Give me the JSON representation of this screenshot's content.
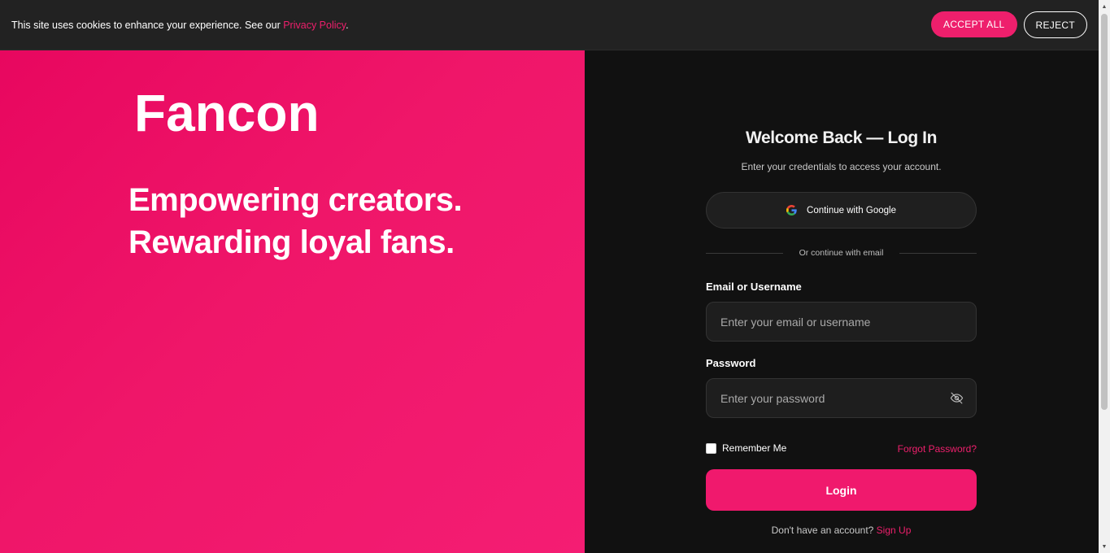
{
  "cookie_bar": {
    "text": "This site uses cookies to enhance your experience. See our ",
    "policy_link": "Privacy Policy",
    "period": ".",
    "accept_label": "ACCEPT ALL",
    "reject_label": "REJECT"
  },
  "hero": {
    "brand": "Fancon",
    "tagline": "Empowering creators. Rewarding loyal fans."
  },
  "login": {
    "title": "Welcome Back — Log In",
    "subtitle": "Enter your credentials to access your account.",
    "google_label": "Continue with Google",
    "divider_text": "Or continue with email",
    "email_label": "Email or Username",
    "email_placeholder": "Enter your email or username",
    "password_label": "Password",
    "password_placeholder": "Enter your password",
    "remember_label": "Remember Me",
    "forgot_label": "Forgot Password?",
    "login_label": "Login",
    "signup_prompt": "Don't have an account?",
    "signup_link": "Sign Up"
  },
  "icons": {
    "google": "google-icon",
    "eye": "eye-off-icon"
  },
  "colors": {
    "accent": "#ee1f6c",
    "hero_bg": "#ef1669",
    "panel_bg": "#111111",
    "input_bg": "#1e1e1e"
  }
}
